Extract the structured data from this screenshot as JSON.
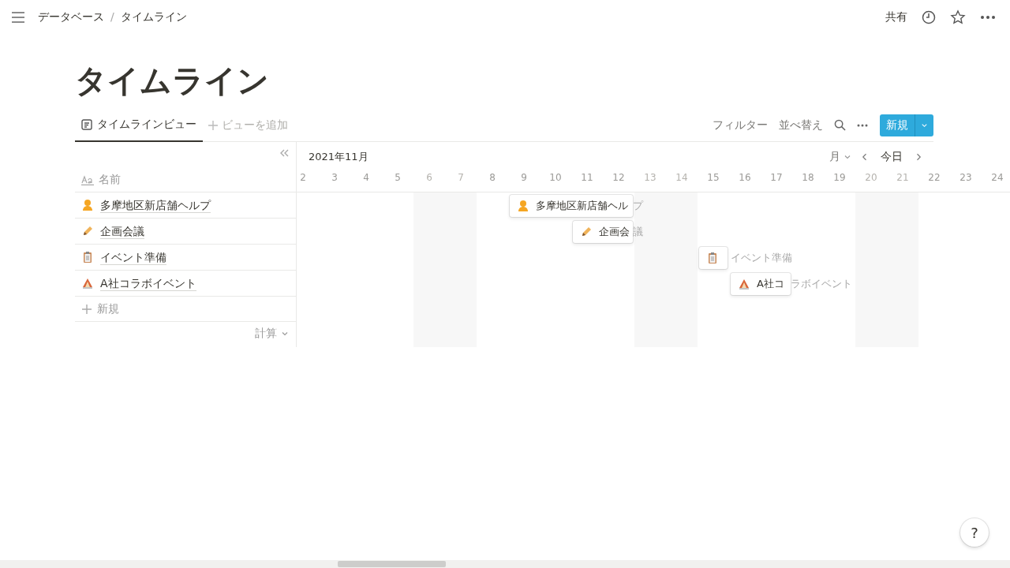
{
  "breadcrumb": [
    "データベース",
    "タイムライン"
  ],
  "breadcrumb_separator": "/",
  "topbar": {
    "share": "共有"
  },
  "title": "タイムライン",
  "views": [
    {
      "label": "タイムラインビュー",
      "selected": true
    }
  ],
  "add_view": "ビューを追加",
  "toolbar": {
    "filter": "フィルター",
    "sort": "並べ替え",
    "new": "新規"
  },
  "table": {
    "column": "名前",
    "new_row": "新規",
    "calc": "計算"
  },
  "rows": [
    {
      "name": "多摩地区新店舗ヘルプ"
    },
    {
      "name": "企画会議"
    },
    {
      "name": "イベント準備"
    },
    {
      "name": "A社コラボイベント"
    }
  ],
  "timeline": {
    "month": "2021年11月",
    "scale": "月",
    "today": "今日",
    "days": [
      {
        "label": "2",
        "weekend": false
      },
      {
        "label": "3",
        "weekend": false
      },
      {
        "label": "4",
        "weekend": false
      },
      {
        "label": "5",
        "weekend": false
      },
      {
        "label": "6",
        "weekend": true
      },
      {
        "label": "7",
        "weekend": true
      },
      {
        "label": "8",
        "weekend": false
      },
      {
        "label": "9",
        "weekend": false
      },
      {
        "label": "10",
        "weekend": false
      },
      {
        "label": "11",
        "weekend": false
      },
      {
        "label": "12",
        "weekend": false
      },
      {
        "label": "13",
        "weekend": true
      },
      {
        "label": "14",
        "weekend": true
      },
      {
        "label": "15",
        "weekend": false
      },
      {
        "label": "16",
        "weekend": false
      },
      {
        "label": "17",
        "weekend": false
      },
      {
        "label": "18",
        "weekend": false
      },
      {
        "label": "19",
        "weekend": false
      },
      {
        "label": "20",
        "weekend": true
      },
      {
        "label": "21",
        "weekend": true
      },
      {
        "label": "22",
        "weekend": false
      },
      {
        "label": "23",
        "weekend": false
      },
      {
        "label": "24",
        "weekend": false
      }
    ],
    "bars": [
      {
        "text_in_bar": "多摩地区新店舗ヘル",
        "text_outside": "プ"
      },
      {
        "text_in_bar": "企画会",
        "text_outside": "議"
      },
      {
        "text_outside": "イベント準備"
      },
      {
        "text_in_bar": "A社コ",
        "text_outside": "ラボイベント"
      }
    ]
  },
  "help": "?"
}
